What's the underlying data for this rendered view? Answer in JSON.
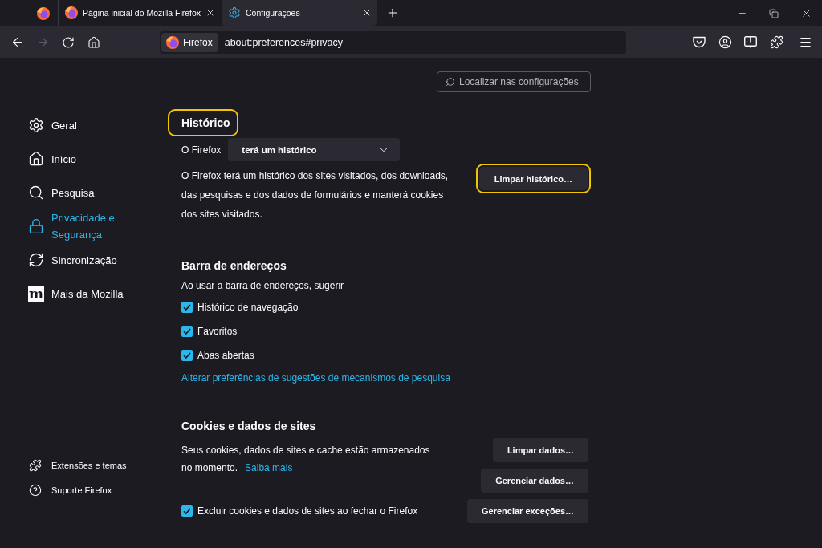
{
  "tabs": [
    {
      "kind": "pinned",
      "selected": false
    },
    {
      "kind": "page",
      "label": "Página inicial do Mozilla Firefox",
      "selected": false
    },
    {
      "kind": "settings",
      "label": "Configurações",
      "selected": true
    }
  ],
  "toolbar": {
    "nav": [
      {
        "kind": "back",
        "disabled": false
      },
      {
        "kind": "forward",
        "disabled": true
      },
      {
        "kind": "reload",
        "disabled": false
      },
      {
        "kind": "home",
        "disabled": false
      }
    ],
    "identity": "Firefox",
    "url": "about:preferences#privacy"
  },
  "search": {
    "placeholder": "Localizar nas configurações"
  },
  "sidebar": {
    "items": [
      {
        "label": "Geral",
        "selected": false
      },
      {
        "label": "Início",
        "selected": false
      },
      {
        "label": "Pesquisa",
        "selected": false
      },
      {
        "label": "Privacidade e Segurança",
        "selected": true
      },
      {
        "label": "Sincronização",
        "selected": false
      },
      {
        "label": "Mais da Mozilla",
        "selected": false,
        "logo_text": "m"
      }
    ],
    "footer": [
      {
        "label": "Extensões e temas"
      },
      {
        "label": "Suporte Firefox"
      }
    ]
  },
  "history": {
    "heading": "Histórico",
    "highlighted": true,
    "select_label": "O Firefox",
    "select_value": "terá um histórico",
    "description": "O Firefox terá um histórico dos sites visitados, dos downloads, das pesquisas e dos dados de formulários e manterá cookies dos sites visitados.",
    "button": {
      "label": "Limpar histórico…",
      "highlighted": true
    }
  },
  "address_bar": {
    "heading": "Barra de endereços",
    "intro": "Ao usar a barra de endereços, sugerir",
    "options": [
      {
        "label": "Histórico de navegação",
        "checked": true
      },
      {
        "label": "Favoritos",
        "checked": true
      },
      {
        "label": "Abas abertas",
        "checked": true
      }
    ],
    "link": "Alterar preferências de sugestões de mecanismos de pesquisa"
  },
  "cookies": {
    "heading": "Cookies e dados de sites",
    "description": "Seus cookies, dados de sites e cache estão armazenados no momento.",
    "link": "Saiba mais",
    "buttons": [
      "Limpar dados…",
      "Gerenciar dados…",
      "Gerenciar exceções…"
    ],
    "option": {
      "label": "Excluir cookies e dados de sites ao fechar o Firefox",
      "checked": true
    }
  }
}
